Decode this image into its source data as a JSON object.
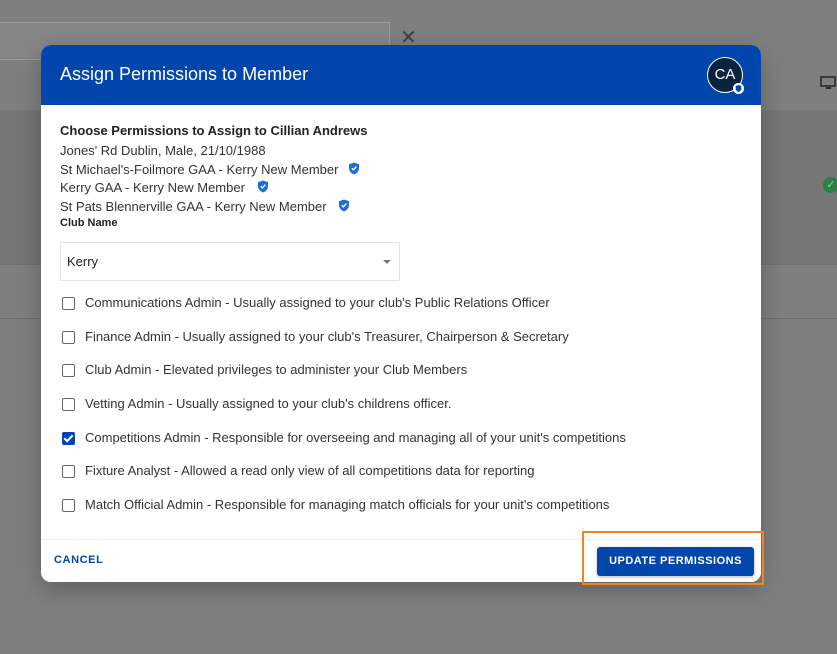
{
  "dialog": {
    "title": "Assign Permissions to Member",
    "avatar_initials": "CA"
  },
  "member": {
    "heading": "Choose Permissions to Assign to Cillian Andrews",
    "details": "Jones' Rd Dublin, Male,  21/10/1988",
    "clubs": [
      "St Michael's-Foilmore GAA - Kerry New Member",
      "Kerry GAA - Kerry New Member",
      "St Pats Blennerville GAA - Kerry New Member"
    ]
  },
  "club_select": {
    "label": "Club Name",
    "value": "Kerry"
  },
  "permissions": [
    {
      "label": "Communications Admin - Usually assigned to your club's Public Relations Officer",
      "checked": false
    },
    {
      "label": "Finance Admin - Usually assigned to your club's Treasurer, Chairperson & Secretary",
      "checked": false
    },
    {
      "label": "Club Admin - Elevated privileges to administer your Club Members",
      "checked": false
    },
    {
      "label": "Vetting Admin - Usually assigned to your club's childrens officer.",
      "checked": false
    },
    {
      "label": "Competitions Admin - Responsible for overseeing and managing all of your unit's competitions",
      "checked": true
    },
    {
      "label": "Fixture Analyst - Allowed a read only view of all competitions data for reporting",
      "checked": false
    },
    {
      "label": "Match Official Admin - Responsible for managing match officials for your unit's competitions",
      "checked": false
    }
  ],
  "footer": {
    "cancel_label": "CANCEL",
    "update_label": "UPDATE PERMISSIONS"
  },
  "colors": {
    "primary": "#0046ad",
    "highlight": "#f58220"
  },
  "icons": {
    "close": "close-icon",
    "shield": "shield-icon",
    "monitor": "monitor-icon",
    "check": "check-circle-icon"
  }
}
